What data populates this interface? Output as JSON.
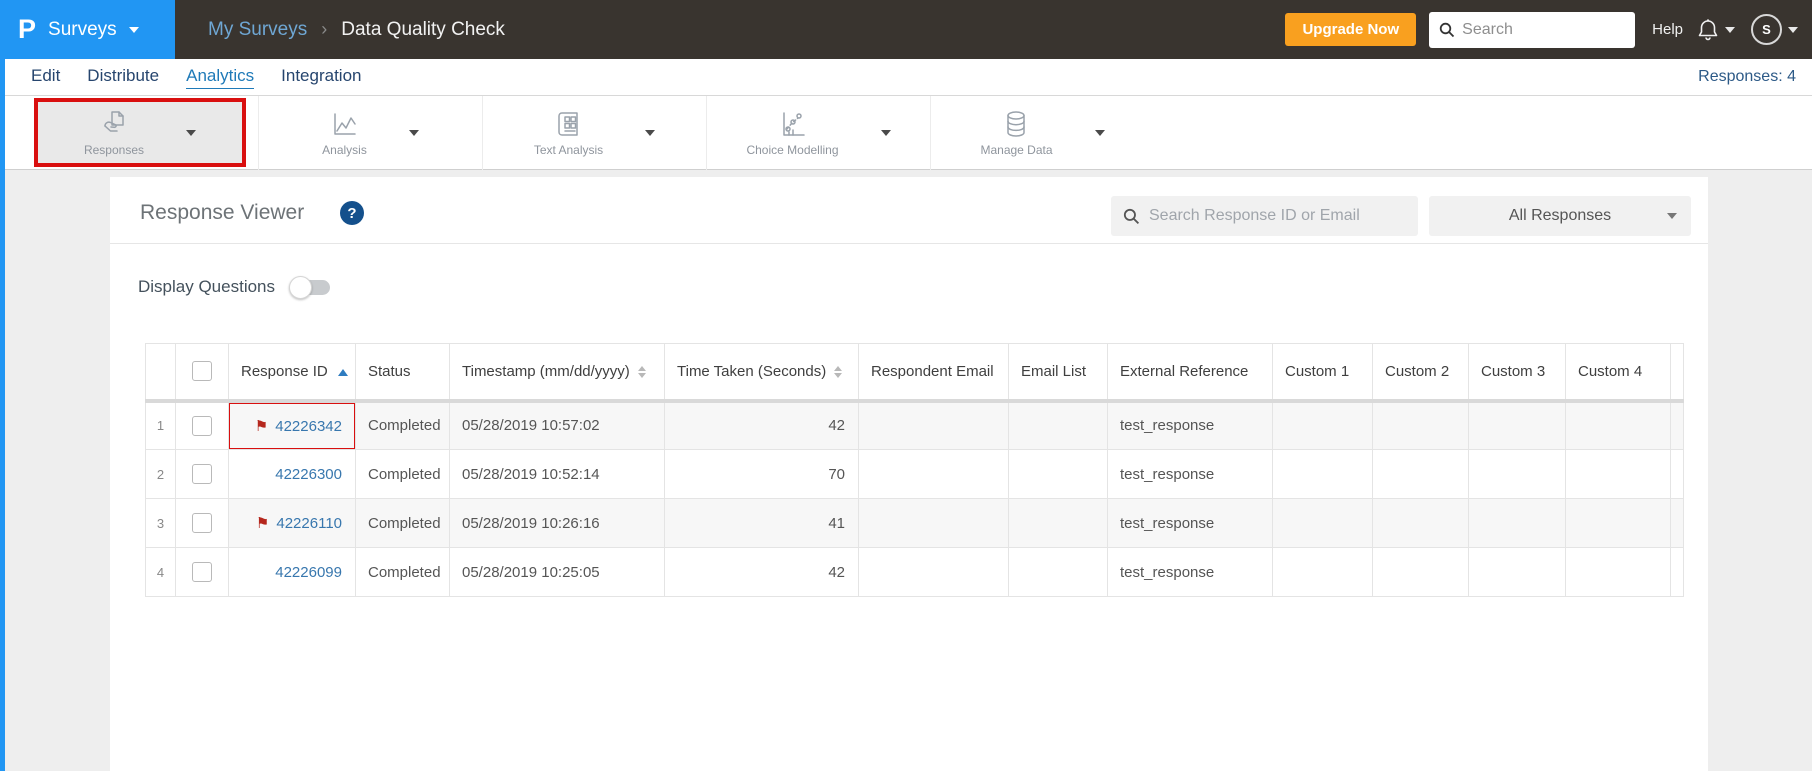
{
  "header": {
    "logo_letter": "P",
    "product": "Surveys",
    "breadcrumb_parent": "My Surveys",
    "breadcrumb_separator": "›",
    "breadcrumb_current": "Data Quality Check",
    "upgrade_label": "Upgrade Now",
    "search_placeholder": "Search",
    "help_label": "Help",
    "avatar_letter": "S"
  },
  "nav": {
    "items": [
      {
        "label": "Edit"
      },
      {
        "label": "Distribute"
      },
      {
        "label": "Analytics",
        "active": true
      },
      {
        "label": "Integration"
      }
    ],
    "responses_count_label": "Responses: 4"
  },
  "toolbar": {
    "tabs": [
      {
        "label": "Responses",
        "icon": "responses-icon",
        "active": true,
        "annotated": true
      },
      {
        "label": "Analysis",
        "icon": "analysis-icon"
      },
      {
        "label": "Text Analysis",
        "icon": "text-analysis-icon"
      },
      {
        "label": "Choice Modelling",
        "icon": "choice-modelling-icon"
      },
      {
        "label": "Manage Data",
        "icon": "manage-data-icon"
      }
    ]
  },
  "viewer": {
    "title": "Response Viewer",
    "help_glyph": "?",
    "search_placeholder": "Search Response ID or Email",
    "filter_value": "All Responses",
    "display_questions_label": "Display Questions",
    "display_questions_on": false
  },
  "table": {
    "columns": [
      {
        "key": "num",
        "label": ""
      },
      {
        "key": "checkbox",
        "label": ""
      },
      {
        "key": "response_id",
        "label": "Response ID",
        "sort": "asc"
      },
      {
        "key": "status",
        "label": "Status"
      },
      {
        "key": "timestamp",
        "label": "Timestamp (mm/dd/yyyy)",
        "sort": "both"
      },
      {
        "key": "time_taken",
        "label": "Time Taken (Seconds)",
        "sort": "both"
      },
      {
        "key": "respondent_email",
        "label": "Respondent Email"
      },
      {
        "key": "email_list",
        "label": "Email List"
      },
      {
        "key": "external_reference",
        "label": "External Reference"
      },
      {
        "key": "custom1",
        "label": "Custom 1"
      },
      {
        "key": "custom2",
        "label": "Custom 2"
      },
      {
        "key": "custom3",
        "label": "Custom 3"
      },
      {
        "key": "custom4",
        "label": "Custom 4"
      },
      {
        "key": "spacer",
        "label": ""
      }
    ],
    "rows": [
      {
        "num": "1",
        "response_id": "42226342",
        "flagged": true,
        "annotated": true,
        "status": "Completed",
        "timestamp": "05/28/2019 10:57:02",
        "time_taken": "42",
        "respondent_email": "",
        "email_list": "",
        "external_reference": "test_response",
        "custom1": "",
        "custom2": "",
        "custom3": "",
        "custom4": ""
      },
      {
        "num": "2",
        "response_id": "42226300",
        "flagged": false,
        "annotated": false,
        "status": "Completed",
        "timestamp": "05/28/2019 10:52:14",
        "time_taken": "70",
        "respondent_email": "",
        "email_list": "",
        "external_reference": "test_response",
        "custom1": "",
        "custom2": "",
        "custom3": "",
        "custom4": ""
      },
      {
        "num": "3",
        "response_id": "42226110",
        "flagged": true,
        "annotated": false,
        "status": "Completed",
        "timestamp": "05/28/2019 10:26:16",
        "time_taken": "41",
        "respondent_email": "",
        "email_list": "",
        "external_reference": "test_response",
        "custom1": "",
        "custom2": "",
        "custom3": "",
        "custom4": ""
      },
      {
        "num": "4",
        "response_id": "42226099",
        "flagged": false,
        "annotated": false,
        "status": "Completed",
        "timestamp": "05/28/2019 10:25:05",
        "time_taken": "42",
        "respondent_email": "",
        "email_list": "",
        "external_reference": "test_response",
        "custom1": "",
        "custom2": "",
        "custom3": "",
        "custom4": ""
      }
    ]
  },
  "colors": {
    "accent_blue": "#2196f3",
    "orange": "#f9a01f",
    "annotation_red": "#d90f0f",
    "link_blue": "#3877ae",
    "flag_red": "#b5271d",
    "active_nav_blue": "#1f7ab8",
    "help_badge_blue": "#14508c"
  }
}
